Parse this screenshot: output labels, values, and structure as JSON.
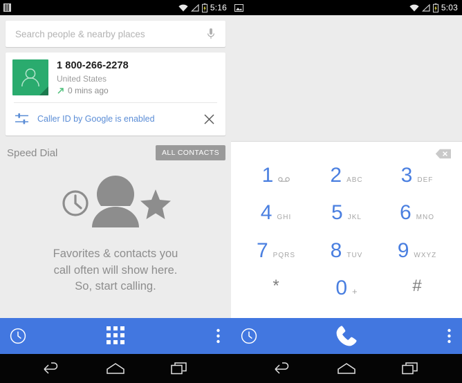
{
  "left": {
    "statusbar": {
      "time": "5:16",
      "icons": [
        "sim-card-icon",
        "wifi-icon",
        "signal-icon",
        "battery-charging-icon"
      ]
    },
    "search": {
      "placeholder": "Search people & nearby places",
      "value": "",
      "mic_icon": "microphone-icon"
    },
    "contact_card": {
      "avatar_icon": "person-avatar-icon",
      "avatar_color": "#2aab6e",
      "number": "1 800-266-2278",
      "country": "United States",
      "call_direction_icon": "outgoing-call-arrow-icon",
      "time_ago": "0 mins ago",
      "caller_id_icon": "tune-sliders-icon",
      "caller_id_text": "Caller ID by Google is enabled",
      "dismiss_icon": "close-icon"
    },
    "speed_dial": {
      "title": "Speed Dial",
      "all_contacts_label": "ALL CONTACTS"
    },
    "empty_state": {
      "art_icons": [
        "clock-icon",
        "person-icon",
        "star-icon"
      ],
      "line1": "Favorites & contacts you",
      "line2": "call often will show here.",
      "line3": "So, start calling."
    },
    "action_bar": {
      "color": "#4277e0",
      "left_icon": "recents-clock-icon",
      "middle_icon": "dialpad-icon",
      "right_icon": "overflow-menu-icon"
    }
  },
  "right": {
    "statusbar": {
      "time": "5:03",
      "icons": [
        "screenshot-image-icon",
        "wifi-icon",
        "signal-icon",
        "battery-charging-icon"
      ]
    },
    "dialpad": {
      "entered_number": "",
      "backspace_icon": "backspace-icon",
      "keys": [
        {
          "digit": "1",
          "letters": "",
          "sub_icon": "voicemail-icon"
        },
        {
          "digit": "2",
          "letters": "ABC",
          "sub_icon": ""
        },
        {
          "digit": "3",
          "letters": "DEF",
          "sub_icon": ""
        },
        {
          "digit": "4",
          "letters": "GHI",
          "sub_icon": ""
        },
        {
          "digit": "5",
          "letters": "JKL",
          "sub_icon": ""
        },
        {
          "digit": "6",
          "letters": "MNO",
          "sub_icon": ""
        },
        {
          "digit": "7",
          "letters": "PQRS",
          "sub_icon": ""
        },
        {
          "digit": "8",
          "letters": "TUV",
          "sub_icon": ""
        },
        {
          "digit": "9",
          "letters": "WXYZ",
          "sub_icon": ""
        },
        {
          "digit": "*",
          "letters": "",
          "sub_icon": ""
        },
        {
          "digit": "0",
          "letters": "+",
          "sub_icon": ""
        },
        {
          "digit": "#",
          "letters": "",
          "sub_icon": ""
        }
      ],
      "key_color": "#4a7fe0",
      "symbol_color": "#7d7d7d"
    },
    "action_bar": {
      "color": "#4277e0",
      "left_icon": "recents-clock-icon",
      "middle_icon": "phone-call-icon",
      "right_icon": "overflow-menu-icon"
    }
  },
  "navbar": {
    "back_icon": "back-arrow-icon",
    "home_icon": "home-icon",
    "recents_icon": "recents-square-icon"
  }
}
